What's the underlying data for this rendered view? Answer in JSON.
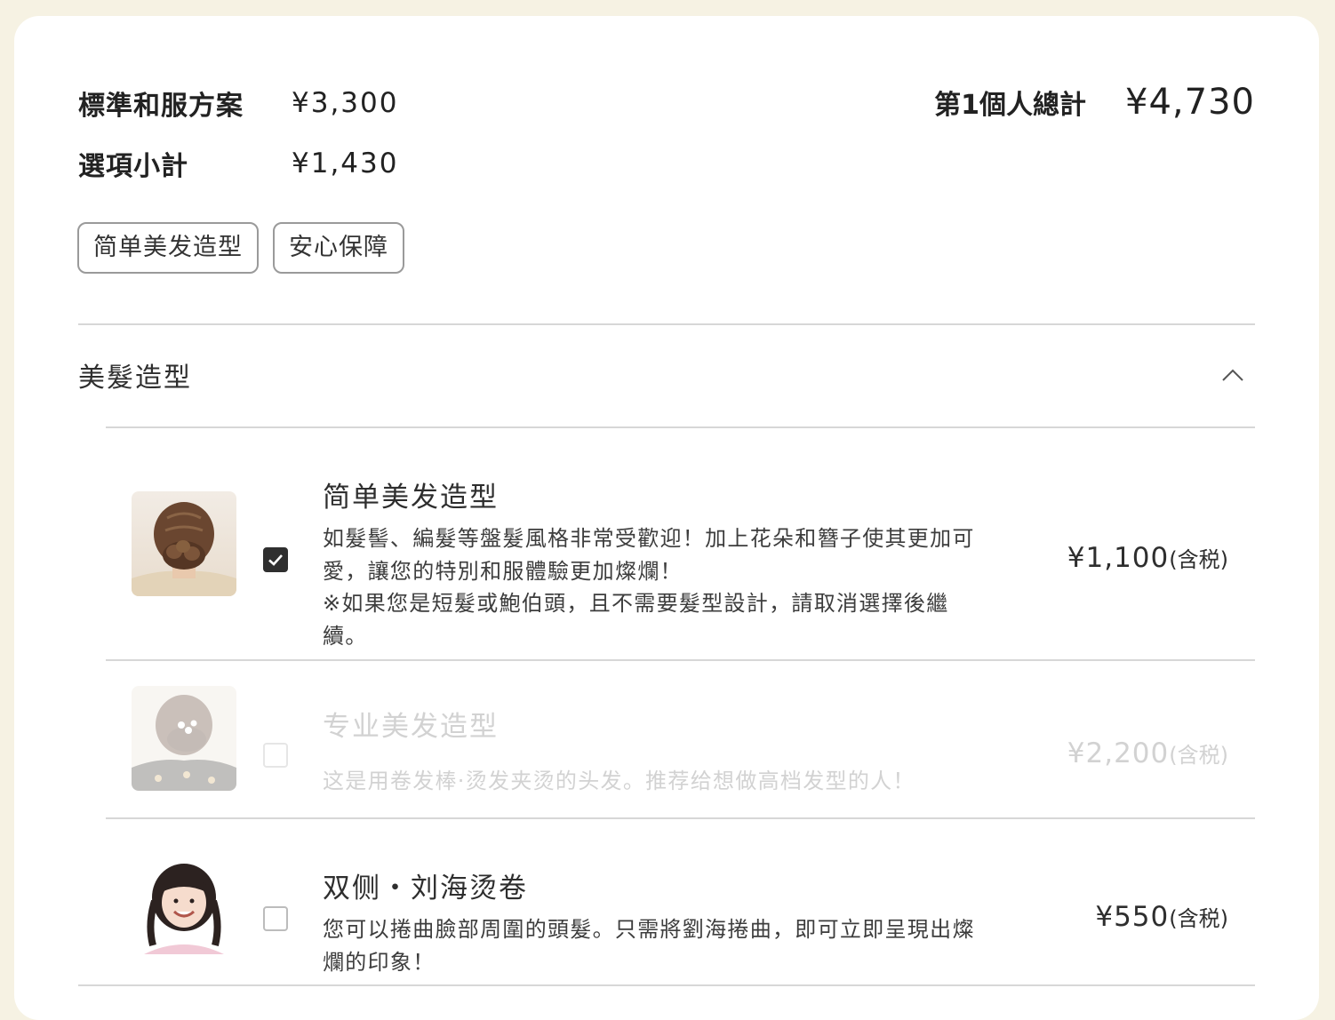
{
  "summary": {
    "plan_label": "標準和服方案",
    "plan_price": "¥3,300",
    "options_label": "選項小計",
    "options_price": "¥1,430",
    "total_label": "第1個人總計",
    "total_price": "¥4,730"
  },
  "tags": [
    "简单美发造型",
    "安心保障"
  ],
  "section": {
    "title": "美髮造型",
    "expanded": true,
    "icon": "chevron-up-icon"
  },
  "options": [
    {
      "title": "简单美发造型",
      "desc_lines": [
        "如髮髻、編髮等盤髮風格非常受歡迎！加上花朵和簪子使其更加可愛，讓您的特別和服體驗更加燦爛！",
        "※如果您是短髮或鮑伯頭，且不需要髮型設計，請取消選擇後繼續。"
      ],
      "price": "¥1,100",
      "tax": "(含税)",
      "checked": true,
      "disabled": false,
      "image": "updo-hairstyle-photo"
    },
    {
      "title": "专业美发造型",
      "desc_lines": [
        "这是用卷发棒·烫发夹烫的头发。推荐给想做高档发型的人！"
      ],
      "price": "¥2,200",
      "tax": "(含税)",
      "checked": false,
      "disabled": true,
      "image": "flower-updo-photo"
    },
    {
      "title": "双侧・刘海烫卷",
      "desc_lines": [
        "您可以捲曲臉部周圍的頭髮。只需將劉海捲曲，即可立即呈現出燦爛的印象！"
      ],
      "price": "¥550",
      "tax": "(含税)",
      "checked": false,
      "disabled": false,
      "image": "twin-braids-portrait-photo"
    }
  ],
  "colors": {
    "page_bg": "#f6f2e3",
    "card_bg": "#ffffff",
    "checkbox_checked": "#2f2f2f",
    "disabled_text": "#d2d2d2"
  }
}
